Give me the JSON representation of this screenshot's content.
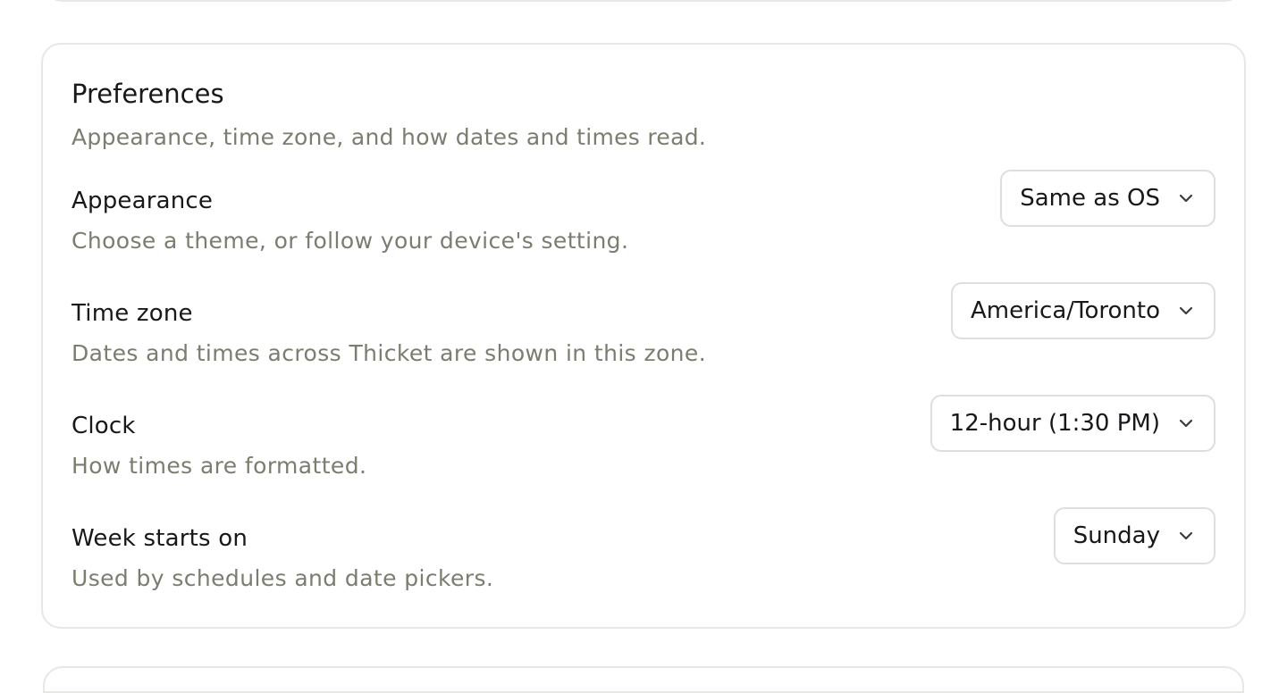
{
  "section": {
    "title": "Preferences",
    "subtitle": "Appearance, time zone, and how dates and times read."
  },
  "rows": [
    {
      "label": "Appearance",
      "description": "Choose a theme, or follow your device's setting.",
      "value": "Same as OS",
      "icon": "chevron-down-icon"
    },
    {
      "label": "Time zone",
      "description": "Dates and times across Thicket are shown in this zone.",
      "value": "America/Toronto",
      "icon": "chevron-down-icon"
    },
    {
      "label": "Clock",
      "description": "How times are formatted.",
      "value": "12-hour (1:30 PM)",
      "icon": "chevron-down-icon"
    },
    {
      "label": "Week starts on",
      "description": "Used by schedules and date pickers.",
      "value": "Sunday",
      "icon": "chevron-down-icon"
    }
  ],
  "colors": {
    "text": "#17181a",
    "muted": "#7a7d6f",
    "border": "#e7e7e4"
  }
}
